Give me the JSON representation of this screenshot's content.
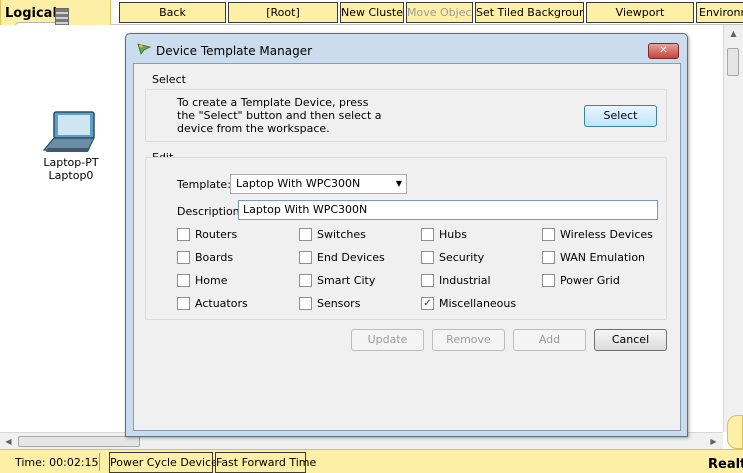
{
  "toolbar": {
    "logical_label": "Logical",
    "back_label": "Back",
    "root_label": "[Root]",
    "new_cluster_label": "New Cluster",
    "move_object_label": "Move Object",
    "set_tiled_bg_label": "Set Tiled Background",
    "viewport_label": "Viewport",
    "environment_label": "Environm"
  },
  "workspace": {
    "device_model": "Laptop-PT",
    "device_name": "Laptop0"
  },
  "dialog": {
    "title": "Device Template Manager",
    "close_glyph": "✕",
    "select_group": {
      "label": "Select",
      "description": "To create a Template Device, press the \"Select\" button and then select a device from the workspace.",
      "select_button": "Select"
    },
    "edit_group": {
      "label": "Edit",
      "template_label": "Template:",
      "template_value": "Laptop With WPC300N",
      "description_label": "Description:",
      "description_value": "Laptop With WPC300N",
      "checkboxes": [
        {
          "label": "Routers",
          "checked": false
        },
        {
          "label": "Switches",
          "checked": false
        },
        {
          "label": "Hubs",
          "checked": false
        },
        {
          "label": "Wireless Devices",
          "checked": false
        },
        {
          "label": "Boards",
          "checked": false
        },
        {
          "label": "End Devices",
          "checked": false
        },
        {
          "label": "Security",
          "checked": false
        },
        {
          "label": "WAN Emulation",
          "checked": false
        },
        {
          "label": "Home",
          "checked": false
        },
        {
          "label": "Smart City",
          "checked": false
        },
        {
          "label": "Industrial",
          "checked": false
        },
        {
          "label": "Power Grid",
          "checked": false
        },
        {
          "label": "Actuators",
          "checked": false
        },
        {
          "label": "Sensors",
          "checked": false
        },
        {
          "label": "Miscellaneous",
          "checked": true
        }
      ]
    },
    "buttons": {
      "update": "Update",
      "remove": "Remove",
      "add": "Add",
      "cancel": "Cancel"
    }
  },
  "bottombar": {
    "time": "Time: 00:02:15",
    "power_cycle_label": "Power Cycle Devices",
    "fast_forward_label": "Fast Forward Time",
    "realtime_label": "Realt"
  },
  "icons": {
    "checkmark": "✓",
    "dropdown_arrow": "▼",
    "scroll_up": "▲",
    "scroll_down": "▼",
    "scroll_left": "◀",
    "scroll_right": "▶"
  },
  "colors": {
    "toolbar_yellow": "#fdf0a6",
    "dialog_frame": "#cbdcee",
    "close_red": "#c5443a"
  }
}
